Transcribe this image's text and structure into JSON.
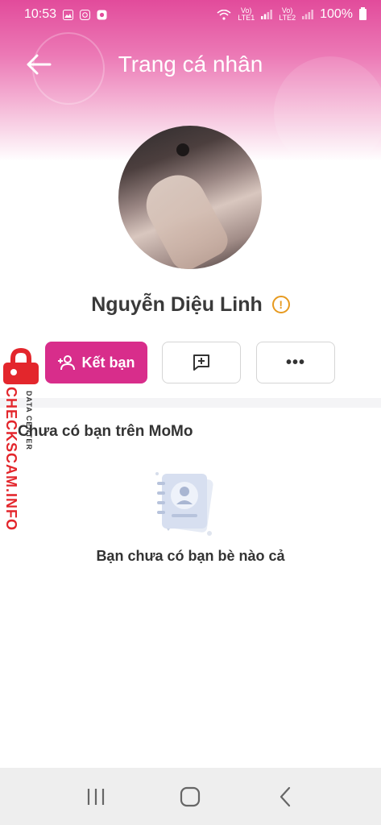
{
  "status_bar": {
    "time": "10:53",
    "sim1": "LTE1",
    "sim2": "LTE2",
    "battery": "100%"
  },
  "header": {
    "title": "Trang cá nhân",
    "back_icon": "arrow-left-icon"
  },
  "profile": {
    "name": "Nguyễn Diệu Linh",
    "warn_icon": "warning-icon"
  },
  "actions": {
    "add_friend_label": "Kết bạn",
    "add_friend_icon": "person-add-icon",
    "message_icon": "chat-add-icon",
    "more_label": "•••"
  },
  "friends": {
    "title": "Chưa có bạn trên MoMo",
    "empty_text": "Bạn chưa có bạn bè nào cả"
  },
  "watermark": {
    "brand": "CHECKSCAM.INFO",
    "sub": "DATA CENTER"
  },
  "colors": {
    "accent": "#d82d8b",
    "warn": "#e79a1f",
    "watermark": "#e3262c"
  }
}
